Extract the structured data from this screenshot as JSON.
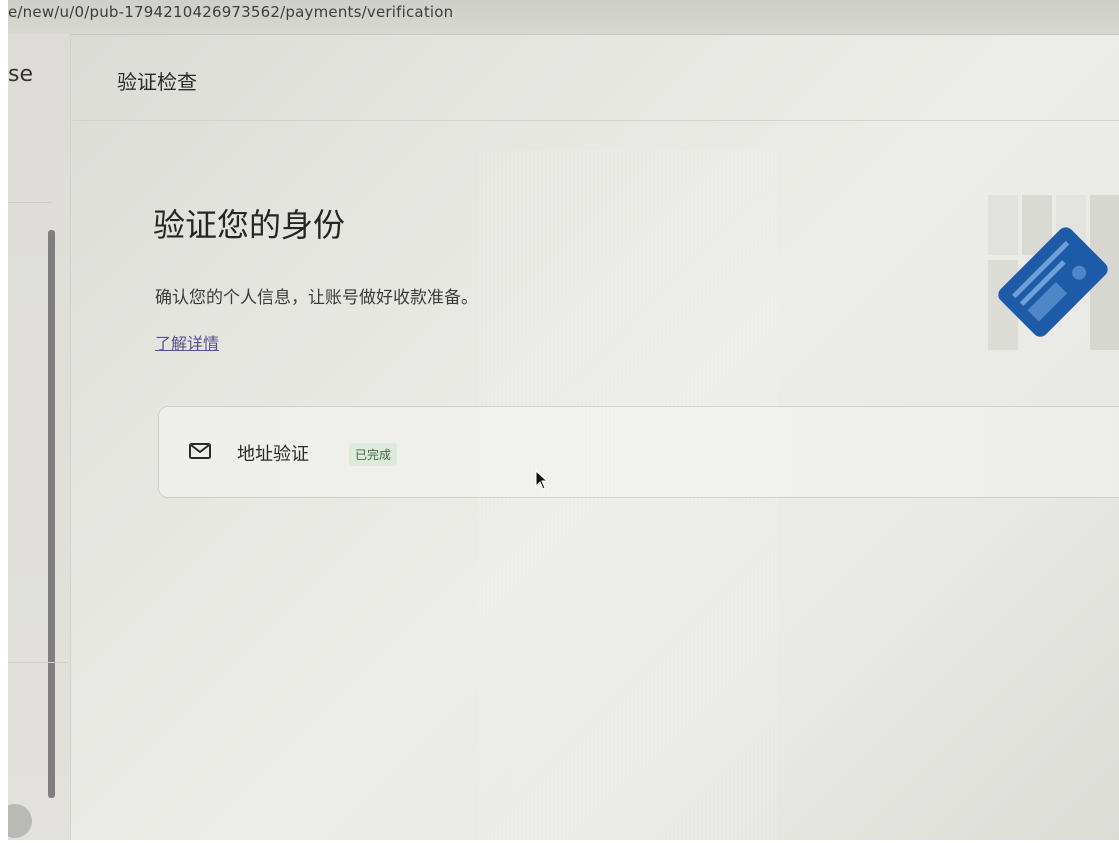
{
  "browser": {
    "url": "e/new/u/0/pub-1794210426973562/payments/verification"
  },
  "sidebar": {
    "brand_fragment": "se"
  },
  "header": {
    "title": "验证检查"
  },
  "main": {
    "title": "验证您的身份",
    "description": "确认您的个人信息，让账号做好收款准备。",
    "learn_more": "了解详情",
    "verification_items": [
      {
        "icon": "mail-icon",
        "label": "地址验证",
        "status": "已完成"
      }
    ]
  },
  "colors": {
    "link": "#5a4f8e",
    "badge_bg": "#dfe9dc",
    "badge_text": "#3b6b45",
    "illustration_blue": "#1d5aa8"
  }
}
